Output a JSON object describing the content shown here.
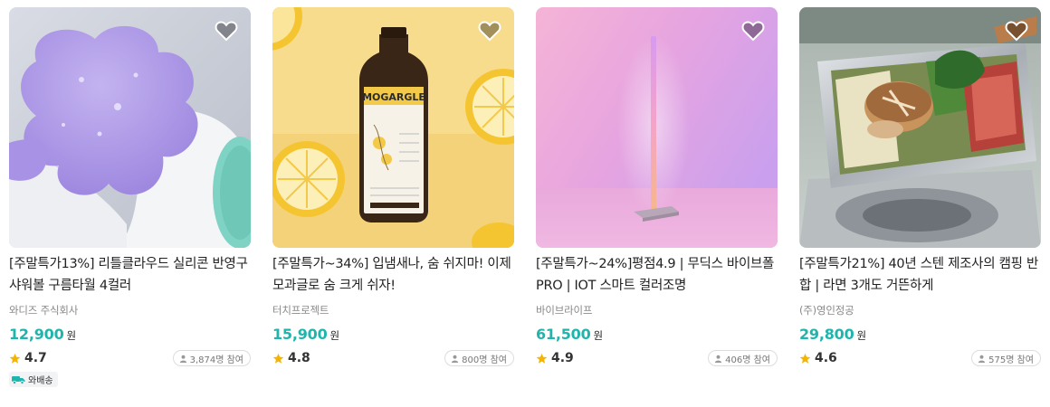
{
  "products": [
    {
      "title": "[주말특가13%] 리틀클라우드 실리콘 반영구 샤워볼 구름타월 4컬러",
      "maker": "와디즈 주식회사",
      "price": "12,900",
      "currency": "원",
      "rating": "4.7",
      "participants": "3,874명 참여",
      "badge": "와배송",
      "image_icon": "purple-silicone-cloud-towel-photo"
    },
    {
      "title": "[주말특가~34%] 입냄새나, 숨 쉬지마! 이제 모과글로 숨 크게 쉬자!",
      "maker": "터치프로젝트",
      "price": "15,900",
      "currency": "원",
      "rating": "4.8",
      "participants": "800명 참여",
      "image_icon": "mogargle-bottle-photo",
      "bottle_label": "MOGARGLE"
    },
    {
      "title": "[주말특가~24%]평점4.9 | 무딕스 바이브폴 PRO | IOT 스마트 컬러조명",
      "maker": "바이브라이프",
      "price": "61,500",
      "currency": "원",
      "rating": "4.9",
      "participants": "406명 참여",
      "image_icon": "led-floor-lamp-photo"
    },
    {
      "title": "[주말특가21%] 40년 스텐 제조사의 캠핑 반합 | 라면 3개도 거뜬하게",
      "maker": "(주)영인정공",
      "price": "29,800",
      "currency": "원",
      "rating": "4.6",
      "participants": "575명 참여",
      "image_icon": "camping-steel-pot-photo"
    }
  ],
  "colors": {
    "price": "#1fb5ad",
    "star": "#f5b400",
    "badge_truck": "#1fb5ad",
    "heart_fill": "rgba(0,0,0,0.35)"
  }
}
